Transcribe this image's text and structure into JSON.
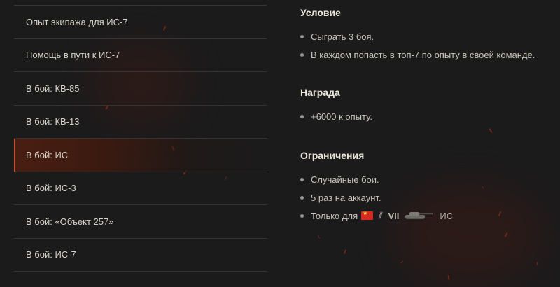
{
  "missions": [
    {
      "label": "Опыт экипажа для ИС-7",
      "active": false
    },
    {
      "label": "Помощь в пути к ИС-7",
      "active": false
    },
    {
      "label": "В бой: КВ-85",
      "active": false
    },
    {
      "label": "В бой: КВ-13",
      "active": false
    },
    {
      "label": "В бой: ИС",
      "active": true
    },
    {
      "label": "В бой: ИС-3",
      "active": false
    },
    {
      "label": "В бой: «Объект 257»",
      "active": false
    },
    {
      "label": "В бой: ИС-7",
      "active": false
    }
  ],
  "details": {
    "conditions": {
      "title": "Условие",
      "items": [
        "Сыграть 3 боя.",
        "В каждом попасть в топ-7 по опыту в своей команде."
      ]
    },
    "reward": {
      "title": "Награда",
      "items": [
        "+6000 к опыту."
      ]
    },
    "limits": {
      "title": "Ограничения",
      "items": [
        "Случайные бои.",
        "5 раз на аккаунт."
      ],
      "vehicle": {
        "prefix": "Только для",
        "nation_icon": "ussr-flag-icon",
        "type_icon": "heavy-tank-icon",
        "tier": "VII",
        "tank_icon": "tank-silhouette-icon",
        "tank_name": "ИС"
      }
    }
  },
  "colors": {
    "background": "#1b1b1c",
    "active_accent": "#c0502a",
    "divider": "#353535"
  }
}
